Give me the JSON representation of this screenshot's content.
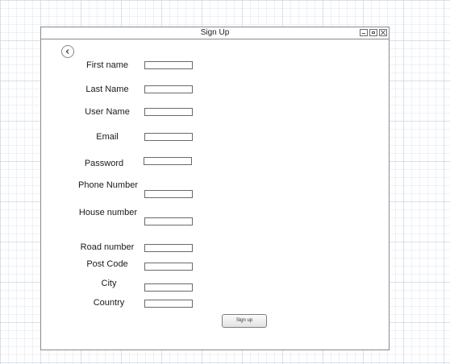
{
  "window": {
    "title": "Sign Up"
  },
  "form": {
    "fields": [
      {
        "key": "first_name",
        "label": "First name",
        "value": ""
      },
      {
        "key": "last_name",
        "label": "Last Name",
        "value": ""
      },
      {
        "key": "user_name",
        "label": "User Name",
        "value": ""
      },
      {
        "key": "email",
        "label": "Email",
        "value": ""
      },
      {
        "key": "password",
        "label": "Password",
        "value": ""
      },
      {
        "key": "phone_number",
        "label": "Phone Number",
        "value": ""
      },
      {
        "key": "house_number",
        "label": "House number",
        "value": ""
      },
      {
        "key": "road_number",
        "label": "Road number",
        "value": ""
      },
      {
        "key": "post_code",
        "label": "Post Code",
        "value": ""
      },
      {
        "key": "city",
        "label": "City",
        "value": ""
      },
      {
        "key": "country",
        "label": "Country",
        "value": ""
      }
    ],
    "submit_label": "Sign up"
  },
  "icons": {
    "back": "chevron-left-icon",
    "minimize": "minimize-icon",
    "maximize": "maximize-icon",
    "close": "close-icon"
  }
}
